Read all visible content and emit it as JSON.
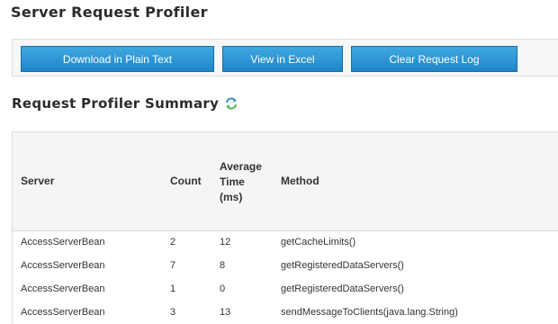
{
  "page": {
    "title": "Server Request Profiler"
  },
  "toolbar": {
    "download_label": "Download in Plain Text",
    "excel_label": "View in Excel",
    "clear_label": "Clear Request Log"
  },
  "summary": {
    "title": "Request Profiler Summary",
    "refresh_icon": "refresh-icon"
  },
  "table": {
    "headers": {
      "server": "Server",
      "count": "Count",
      "avg_line1": "Average",
      "avg_line2": "Time",
      "avg_line3": "(ms)",
      "method": "Method"
    },
    "rows": [
      {
        "server": "AccessServerBean",
        "count": "2",
        "avg": "12",
        "method": "getCacheLimits()"
      },
      {
        "server": "AccessServerBean",
        "count": "7",
        "avg": "8",
        "method": "getRegisteredDataServers()"
      },
      {
        "server": "AccessServerBean",
        "count": "1",
        "avg": "0",
        "method": "getRegisteredDataServers()"
      },
      {
        "server": "AccessServerBean",
        "count": "3",
        "avg": "13",
        "method": "sendMessageToClients(java.lang.String)"
      }
    ]
  },
  "colors": {
    "button": "#1f86c8",
    "header_bg": "#f5f5f5",
    "border": "#dcdcdc"
  }
}
